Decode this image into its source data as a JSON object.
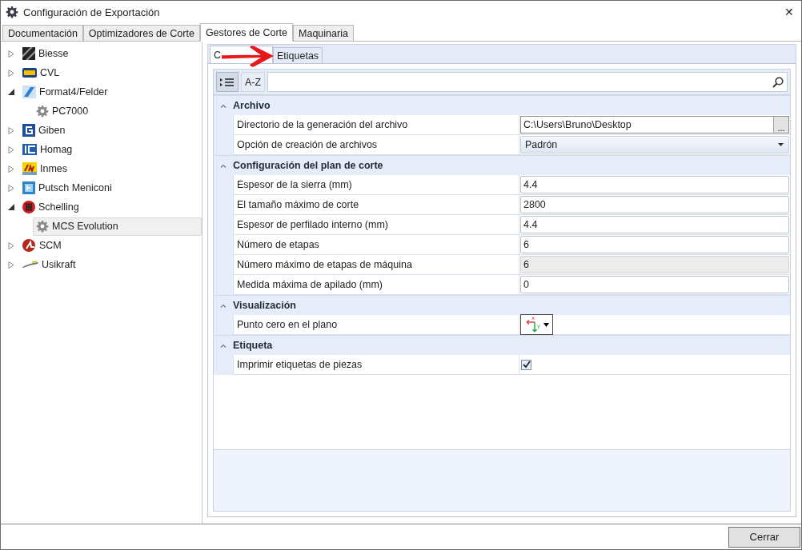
{
  "window": {
    "title": "Configuración de Exportación",
    "close": "✕"
  },
  "tabs": [
    {
      "label": "Documentación",
      "selected": false
    },
    {
      "label": "Optimizadores de Corte",
      "selected": false
    },
    {
      "label": "Gestores de Corte",
      "selected": true
    },
    {
      "label": "Maquinaria",
      "selected": false
    }
  ],
  "tree": [
    {
      "label": "Biesse",
      "expanded": false,
      "selected": false
    },
    {
      "label": "CVL",
      "expanded": false,
      "selected": false
    },
    {
      "label": "Format4/Felder",
      "expanded": true,
      "selected": false,
      "children": [
        {
          "label": "PC7000",
          "selected": false
        }
      ]
    },
    {
      "label": "Giben",
      "expanded": false,
      "selected": false
    },
    {
      "label": "Homag",
      "expanded": false,
      "selected": false
    },
    {
      "label": "Inmes",
      "expanded": false,
      "selected": false
    },
    {
      "label": "Putsch Meniconi",
      "expanded": false,
      "selected": false
    },
    {
      "label": "Schelling",
      "expanded": true,
      "selected": false,
      "children": [
        {
          "label": "MCS Evolution",
          "selected": true
        }
      ]
    },
    {
      "label": "SCM",
      "expanded": false,
      "selected": false
    },
    {
      "label": "Usikraft",
      "expanded": false,
      "selected": false
    }
  ],
  "subtabs": [
    {
      "label": "C",
      "selected": true
    },
    {
      "label": "Etiquetas",
      "selected": false
    }
  ],
  "toolbar": {
    "categorized": {
      "selected": true
    },
    "alphabetical": {
      "label": "A-Z",
      "selected": false
    }
  },
  "sections": [
    {
      "title": "Archivo",
      "expanded": true,
      "rows": [
        {
          "kind": "path",
          "name": "Directorio de  la generación del archivo",
          "value": "C:\\Users\\Bruno\\Desktop",
          "button": "..."
        },
        {
          "kind": "dropdown",
          "name": "Opción de creación de archivos",
          "value": "Padrón"
        }
      ]
    },
    {
      "title": "Configuración del plan de corte",
      "expanded": true,
      "rows": [
        {
          "kind": "text",
          "name": "Espesor de la sierra (mm)",
          "value": "4.4",
          "disabled": false
        },
        {
          "kind": "text",
          "name": "El tamaño máximo de corte",
          "value": "2800",
          "disabled": false
        },
        {
          "kind": "text",
          "name": "Espesor de perfilado interno (mm)",
          "value": "4.4",
          "disabled": false
        },
        {
          "kind": "text",
          "name": "Número de etapas",
          "value": "6",
          "disabled": false
        },
        {
          "kind": "text",
          "name": "Número máximo de etapas de máquina",
          "value": "6",
          "disabled": true
        },
        {
          "kind": "text",
          "name": "Medida máxima de apilado (mm)",
          "value": "0",
          "disabled": false
        }
      ]
    },
    {
      "title": "Visualización",
      "expanded": true,
      "rows": [
        {
          "kind": "origin",
          "name": "Punto cero en el plano",
          "x_label": "x",
          "y_label": "y"
        }
      ]
    },
    {
      "title": "Etiqueta",
      "expanded": true,
      "rows": [
        {
          "kind": "checkbox",
          "name": "Imprimir etiquetas de piezas",
          "checked": true
        }
      ]
    }
  ],
  "footer": {
    "button": "Cerrar"
  }
}
